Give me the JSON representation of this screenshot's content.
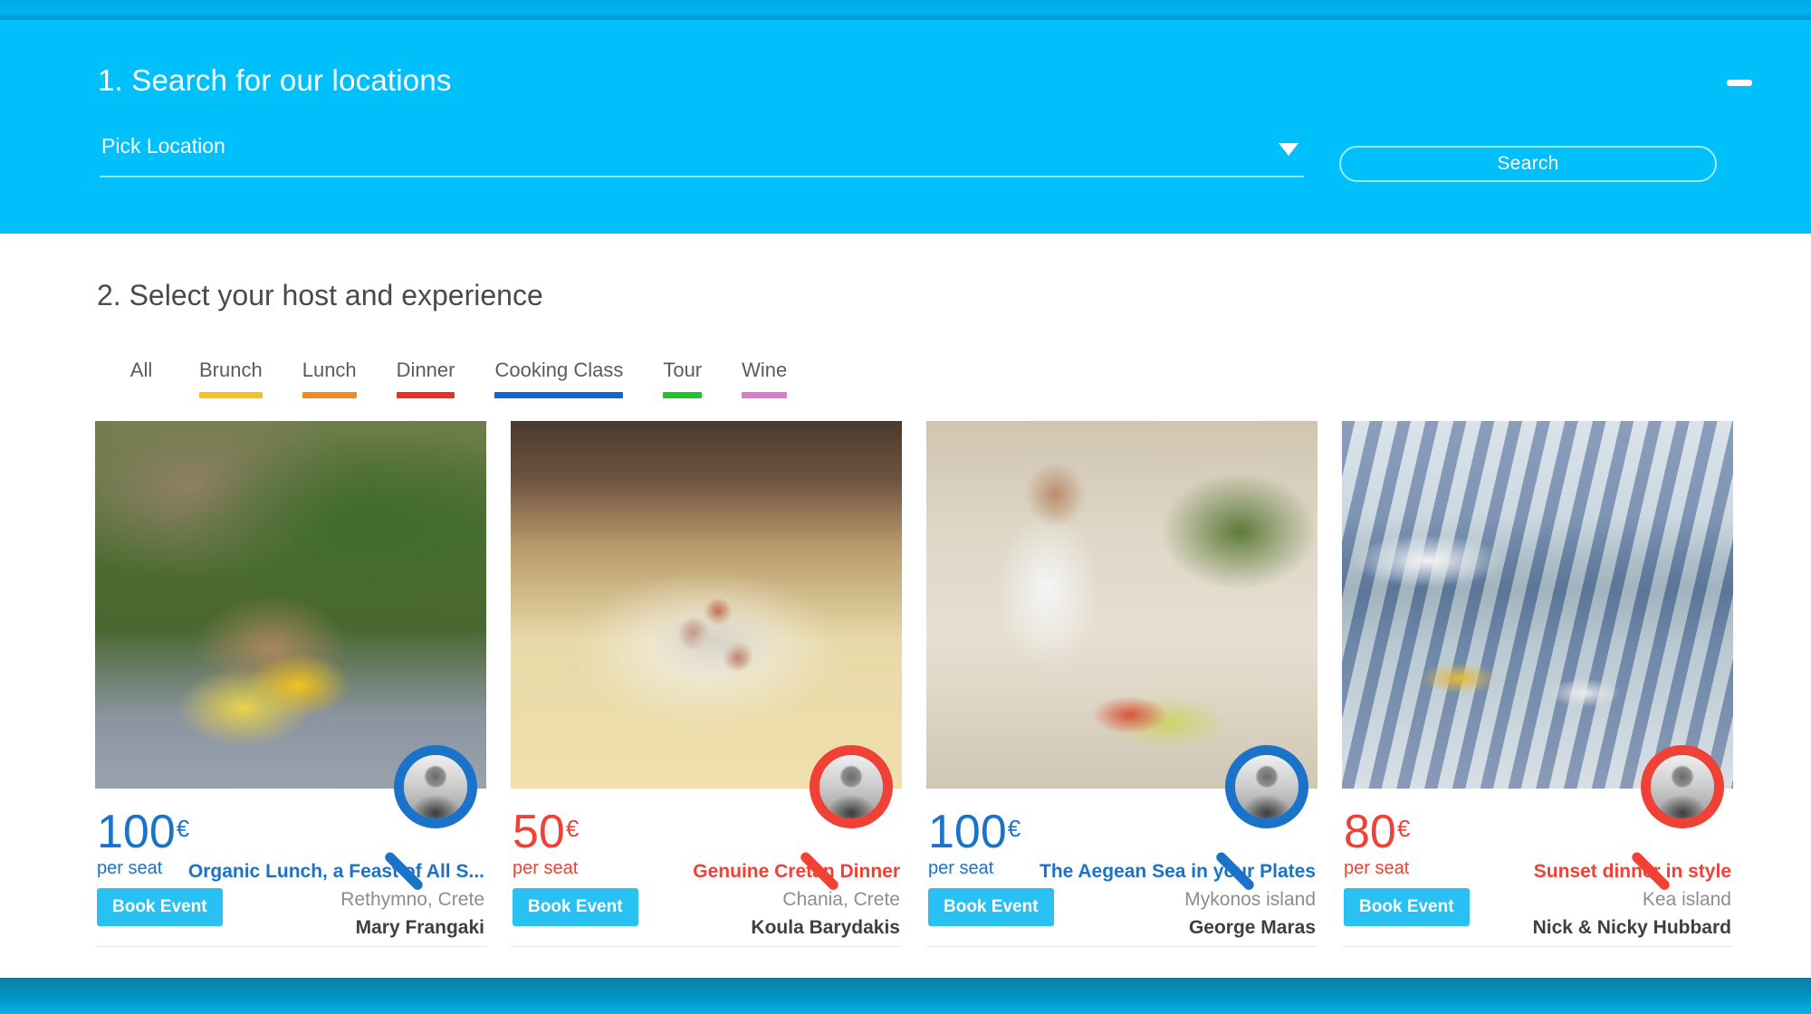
{
  "theme": {
    "panel_blue": "#00c0fb",
    "button_cyan": "#29c0f4",
    "accent_blue": "#1a73c8",
    "accent_red": "#ef4136"
  },
  "search_panel": {
    "title": "1. Search for our locations",
    "collapse_icon": "minimize-icon",
    "location_select": {
      "value": "Pick Location",
      "caret_icon": "chevron-down-icon"
    },
    "search_button": "Search"
  },
  "select_section": {
    "title": "2. Select your host and experience",
    "tabs": [
      {
        "label": "All",
        "underline": "transparent"
      },
      {
        "label": "Brunch",
        "underline": "#fbbf24"
      },
      {
        "label": "Lunch",
        "underline": "#f08a24"
      },
      {
        "label": "Dinner",
        "underline": "#ed2e24"
      },
      {
        "label": "Cooking Class",
        "underline": "#1464d2"
      },
      {
        "label": "Tour",
        "underline": "#22c12e"
      },
      {
        "label": "Wine",
        "underline": "#dd7bca"
      }
    ],
    "cards": [
      {
        "photo_alt": "basket-of-courgette-flowers",
        "price": "100",
        "currency": "€",
        "per_seat": "per seat",
        "book_label": "Book Event",
        "event_title": "Organic Lunch, a Feast of All S...",
        "place": "Rethymno, Crete",
        "host": "Mary Frangaki",
        "accent": "#1a73c8",
        "avatar_alt": "host-photo-mary-frangaki"
      },
      {
        "photo_alt": "plate-of-cretan-meatballs",
        "price": "50",
        "currency": "€",
        "per_seat": "per seat",
        "book_label": "Book Event",
        "event_title": "Genuine Cretan Dinner",
        "place": "Chania, Crete",
        "host": "Koula Barydakis",
        "accent": "#ef4136",
        "avatar_alt": "host-photo-koula-barydakis"
      },
      {
        "photo_alt": "chef-preparing-seafood",
        "price": "100",
        "currency": "€",
        "per_seat": "per seat",
        "book_label": "Book Event",
        "event_title": "The Aegean Sea in your Plates",
        "place": "Mykonos island",
        "host": "George Maras",
        "accent": "#1a73c8",
        "avatar_alt": "host-photo-george-maras"
      },
      {
        "photo_alt": "seaside-dinner-table",
        "price": "80",
        "currency": "€",
        "per_seat": "per seat",
        "book_label": "Book Event",
        "event_title": "Sunset dinner in style",
        "place": "Kea island",
        "host": "Nick & Nicky Hubbard",
        "accent": "#ef4136",
        "avatar_alt": "host-photo-nick-and-nicky-hubbard"
      }
    ]
  }
}
